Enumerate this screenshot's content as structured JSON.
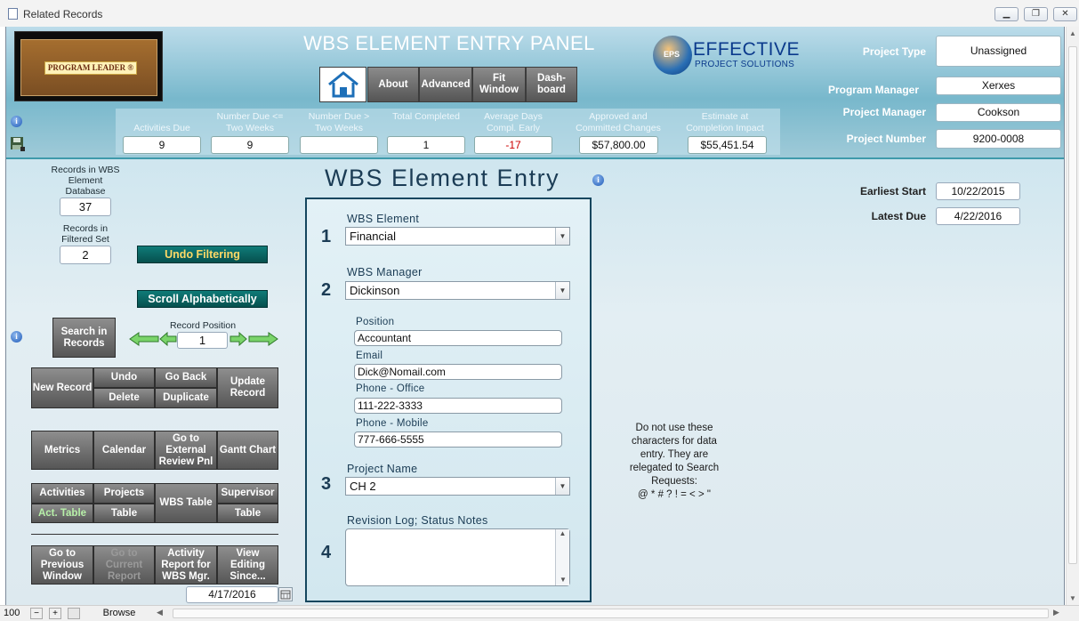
{
  "window": {
    "title": "Related Records",
    "controls": [
      "minimize",
      "restore",
      "close"
    ]
  },
  "header": {
    "logo_text": "PROGRAM LEADER ®",
    "panel_title": "WBS ELEMENT ENTRY PANEL",
    "nav": [
      {
        "label": "About"
      },
      {
        "label": "Advanced"
      },
      {
        "label": "Fit Window"
      },
      {
        "label": "Dash-board"
      }
    ],
    "brand_name": "EFFECTIVE",
    "brand_sub": "PROJECT SOLUTIONS",
    "brand_mark": "EPS",
    "project_type_label": "Project Type",
    "project_type": "Unassigned",
    "program_manager_label": "Program Manager",
    "program_manager": "Xerxes",
    "project_manager_label": "Project Manager",
    "project_manager": "Cookson",
    "project_number_label": "Project Number",
    "project_number": "9200-0008"
  },
  "stats": [
    {
      "label": "Activities Due",
      "value": "9"
    },
    {
      "label": "Number Due <= Two Weeks",
      "value": "9"
    },
    {
      "label": "Number Due > Two Weeks",
      "value": ""
    },
    {
      "label": "Total Completed",
      "value": "1"
    },
    {
      "label": "Average Days Compl. Early",
      "value": "-17"
    },
    {
      "label": "Approved and Committed Changes",
      "value": "$57,800.00"
    },
    {
      "label": "Estimate at Completion Impact",
      "value": "$55,451.54"
    }
  ],
  "left": {
    "records_db_label": "Records in WBS Element Database",
    "records_db": "37",
    "records_filtered_label": "Records in Filtered Set",
    "records_filtered": "2",
    "undo_filtering": "Undo Filtering",
    "scroll_alpha": "Scroll Alphabetically",
    "search_records": "Search in Records",
    "record_position_label": "Record Position",
    "record_position": "1",
    "buttons_row1": {
      "new_record": "New Record",
      "undo": "Undo",
      "delete": "Delete",
      "go_back": "Go Back",
      "duplicate": "Duplicate",
      "update_record": "Update Record"
    },
    "buttons_row2": {
      "metrics": "Metrics",
      "calendar": "Calendar",
      "external": "Go to External Review Pnl",
      "gantt": "Gantt Chart"
    },
    "buttons_row3": {
      "activities": "Activities",
      "act_table": "Act. Table",
      "projects": "Projects",
      "table1": "Table",
      "wbs_table": "WBS Table",
      "supervisor": "Supervisor",
      "table2": "Table"
    },
    "buttons_row4": {
      "prev_window": "Go to Previous Window",
      "current_report": "Go to Current Report",
      "activity_report": "Activity Report for WBS Mgr.",
      "view_editing": "View Editing Since..."
    },
    "since_date": "4/17/2016"
  },
  "entry": {
    "title": "WBS Element Entry",
    "wbs_element_label": "WBS Element",
    "wbs_element": "Financial",
    "wbs_manager_label": "WBS Manager",
    "wbs_manager": "Dickinson",
    "position_label": "Position",
    "position": "Accountant",
    "email_label": "Email",
    "email": "Dick@Nomail.com",
    "phone_office_label": "Phone - Office",
    "phone_office": "111-222-3333",
    "phone_mobile_label": "Phone - Mobile",
    "phone_mobile": "777-666-5555",
    "project_name_label": "Project Name",
    "project_name": "CH 2",
    "revision_label": "Revision Log; Status Notes",
    "revision": "",
    "step_numbers": [
      "1",
      "2",
      "3",
      "4"
    ]
  },
  "dates": {
    "earliest_start_label": "Earliest Start",
    "earliest_start": "10/22/2015",
    "latest_due_label": "Latest Due",
    "latest_due": "4/22/2016"
  },
  "note": "Do not use these characters for data entry.  They are relegated to Search Requests:\n@ * # ? ! = < > \"",
  "statusbar": {
    "zoom": "100",
    "mode": "Browse"
  },
  "colors": {
    "header_blue": "#78b8cc",
    "teal_button": "#0f7b78",
    "entry_border": "#15465e",
    "negative": "#cc0000"
  }
}
